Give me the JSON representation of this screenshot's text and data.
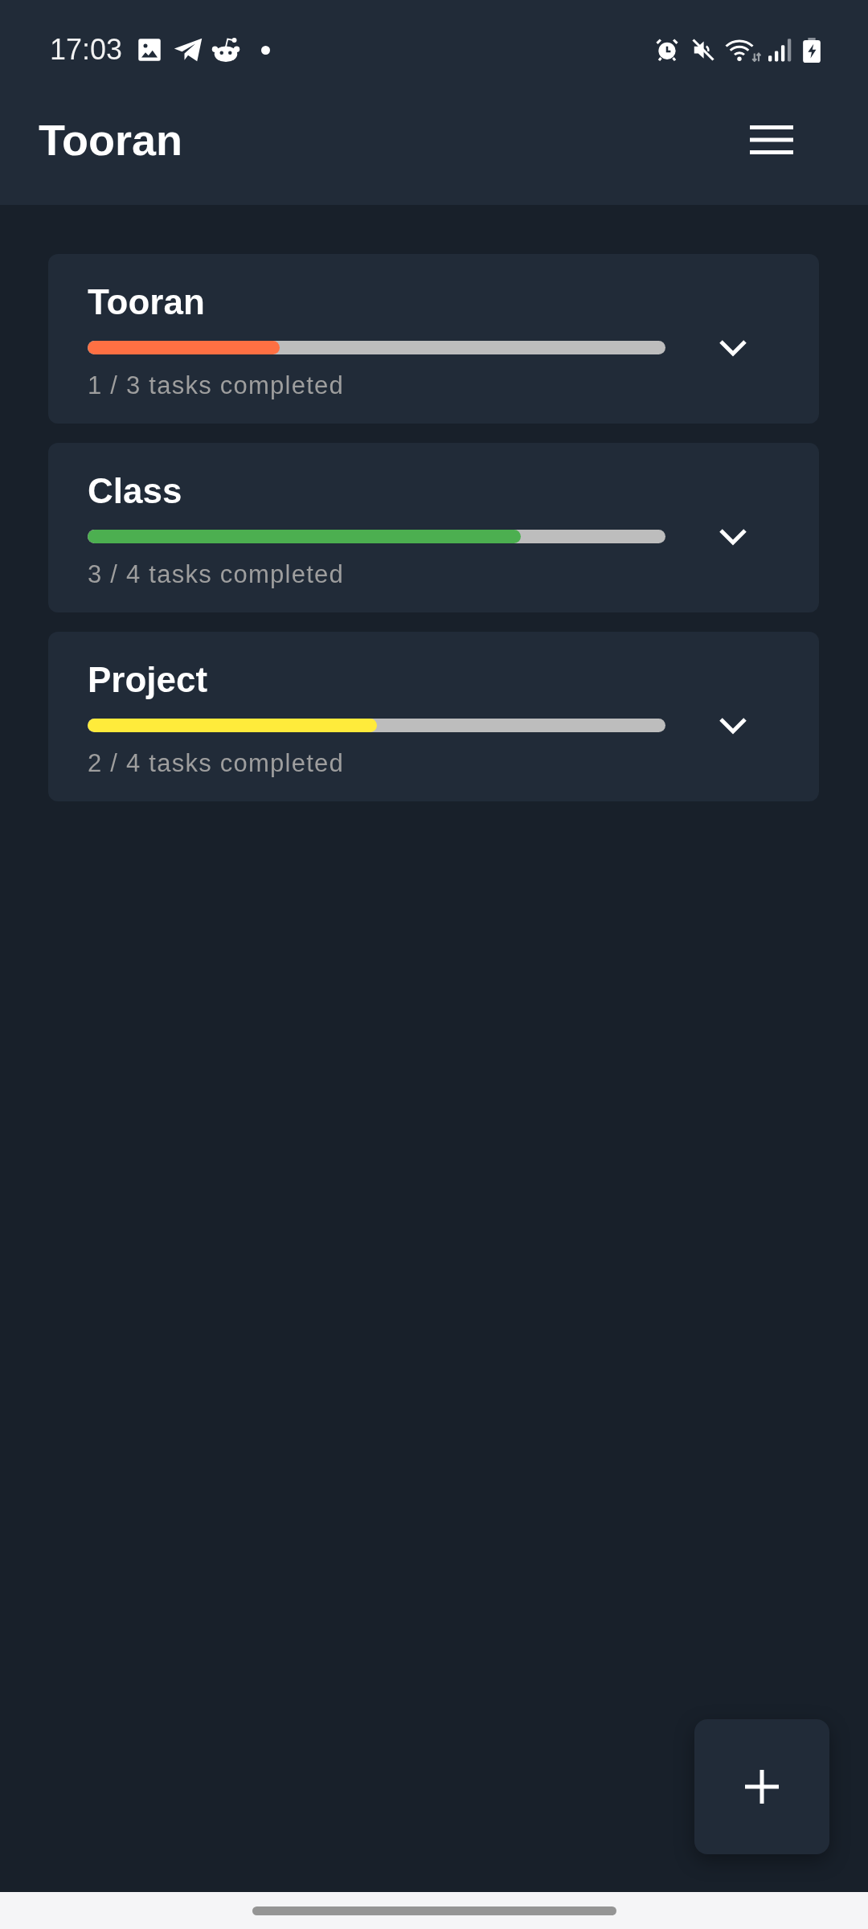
{
  "status_bar": {
    "time": "17:03"
  },
  "app_bar": {
    "title": "Tooran"
  },
  "projects": [
    {
      "name": "Tooran",
      "level": 0.333,
      "color": "#ff7043",
      "summary": "1 / 3 tasks completed",
      "expanded": false
    },
    {
      "name": "Class",
      "level": 0.75,
      "color": "#4caf50",
      "summary": "3 / 4 tasks completed",
      "expanded": false
    },
    {
      "name": "Project",
      "level": 0.5,
      "color": "#ffeb3b",
      "summary": "2 / 4 tasks completed",
      "expanded": false
    }
  ]
}
